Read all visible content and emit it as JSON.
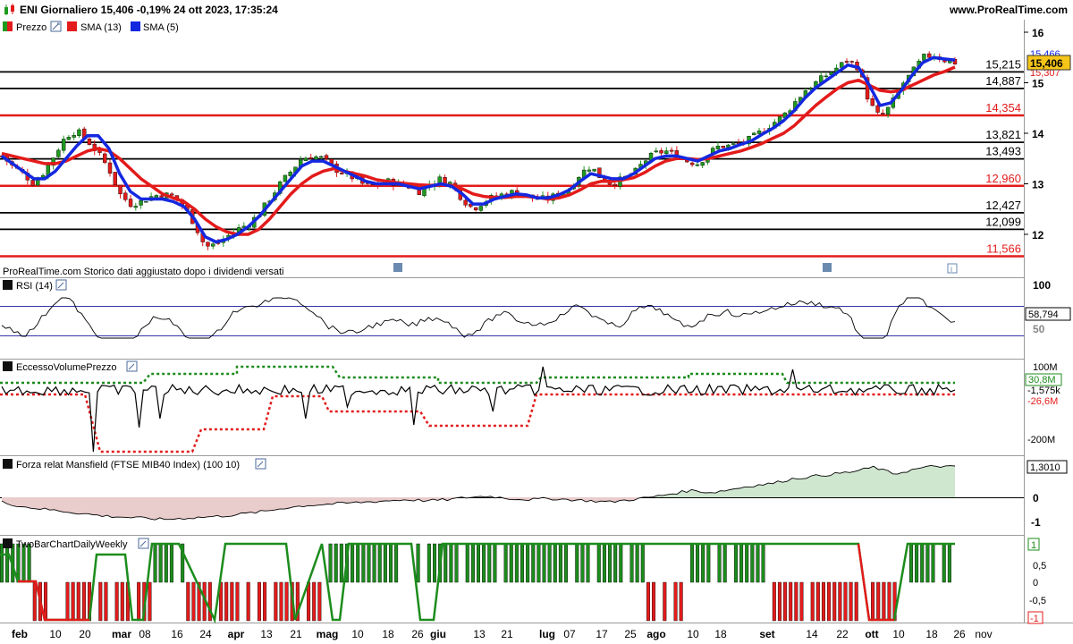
{
  "header": {
    "title": "ENI Giornaliero 15,406 -0,19% 24 ott 2023, 17:35:24",
    "site": "www.ProRealTime.com"
  },
  "colors": {
    "up": "#1f9a1f",
    "down": "#e31b1b",
    "sma_fast": "#1428e0",
    "sma_slow": "#e31b1b",
    "hline_black": "#000000",
    "hline_red": "#e31b1b",
    "rsi_band": "#3333aa",
    "volume_green": "#1c8c1c",
    "volume_red": "#e31b1b",
    "mansfield_pos_fill": "#cfe6cf",
    "mansfield_neg_fill": "#e9cccc",
    "twobar_green": "#1c8c1c",
    "twobar_red": "#e31b1b"
  },
  "panels": {
    "price": {
      "legend": [
        {
          "label": "Prezzo",
          "color": "#1f9a1f",
          "icon": "price-legend-icon"
        },
        {
          "label": "SMA (13)",
          "color": "#e31b1b",
          "icon": "sma13-legend-icon"
        },
        {
          "label": "SMA (5)",
          "color": "#1428e0",
          "icon": "sma5-legend-icon"
        }
      ],
      "note": "ProRealTime.com  Storico dati aggiustato dopo i dividendi versati",
      "y_ticks": [
        "16",
        "15",
        "14",
        "13",
        "12"
      ],
      "current_price": "15,406",
      "last_sma5": "15,466",
      "last_sma13": "15,307"
    },
    "rsi": {
      "title": "RSI (14)",
      "ticks": [
        "100",
        "50"
      ],
      "last": "58,794"
    },
    "volume": {
      "title": "EccessoVolumePrezzo",
      "ticks": [
        "100M",
        "-200M"
      ],
      "last_upper": "30,8M",
      "last_value": "-1,575k",
      "last_lower": "-26,6M"
    },
    "mansfield": {
      "title": "Forza relat Mansfield (FTSE MIB40 Index) (100 10)",
      "ticks": [
        "0",
        "-1"
      ],
      "last": "1,3010"
    },
    "twobar": {
      "title": "TwoBarChartDailyWeekly",
      "ticks": [
        "0,5",
        "0",
        "-0,5"
      ],
      "last_upper": "1",
      "last_lower": "-1"
    }
  },
  "x_axis": {
    "labels": [
      {
        "text": "feb",
        "bold": true
      },
      {
        "text": "10",
        "bold": false
      },
      {
        "text": "20",
        "bold": false
      },
      {
        "text": "mar",
        "bold": true
      },
      {
        "text": "08",
        "bold": false
      },
      {
        "text": "16",
        "bold": false
      },
      {
        "text": "24",
        "bold": false
      },
      {
        "text": "apr",
        "bold": true
      },
      {
        "text": "13",
        "bold": false
      },
      {
        "text": "21",
        "bold": false
      },
      {
        "text": "mag",
        "bold": true
      },
      {
        "text": "10",
        "bold": false
      },
      {
        "text": "18",
        "bold": false
      },
      {
        "text": "26",
        "bold": false
      },
      {
        "text": "giu",
        "bold": true
      },
      {
        "text": "13",
        "bold": false
      },
      {
        "text": "21",
        "bold": false
      },
      {
        "text": "lug",
        "bold": true
      },
      {
        "text": "07",
        "bold": false
      },
      {
        "text": "17",
        "bold": false
      },
      {
        "text": "25",
        "bold": false
      },
      {
        "text": "ago",
        "bold": true
      },
      {
        "text": "10",
        "bold": false
      },
      {
        "text": "18",
        "bold": false
      },
      {
        "text": "set",
        "bold": true
      },
      {
        "text": "14",
        "bold": false
      },
      {
        "text": "22",
        "bold": false
      },
      {
        "text": "ott",
        "bold": true
      },
      {
        "text": "10",
        "bold": false
      },
      {
        "text": "18",
        "bold": false
      },
      {
        "text": "26",
        "bold": false
      },
      {
        "text": "nov",
        "bold": false
      }
    ]
  },
  "chart_data": {
    "type": "line",
    "title": "ENI Giornaliero",
    "ylim": [
      11.3,
      16.3
    ],
    "horizontal_levels": [
      {
        "value": 15.215,
        "label": "15,215",
        "color": "black"
      },
      {
        "value": 14.887,
        "label": "14,887",
        "color": "black"
      },
      {
        "value": 14.354,
        "label": "14,354",
        "color": "red"
      },
      {
        "value": 13.821,
        "label": "13,821",
        "color": "black"
      },
      {
        "value": 13.493,
        "label": "13,493",
        "color": "black"
      },
      {
        "value": 12.96,
        "label": "12,960",
        "color": "red"
      },
      {
        "value": 12.427,
        "label": "12,427",
        "color": "black"
      },
      {
        "value": 12.099,
        "label": "12,099",
        "color": "black"
      },
      {
        "value": 11.566,
        "label": "11,566",
        "color": "red"
      }
    ],
    "price_path": [
      13.55,
      13.35,
      13.2,
      13.0,
      13.25,
      13.6,
      13.95,
      14.05,
      13.85,
      13.6,
      13.3,
      12.8,
      12.6,
      12.65,
      12.75,
      12.8,
      12.75,
      12.55,
      12.2,
      11.75,
      11.8,
      11.95,
      12.1,
      12.2,
      12.4,
      12.7,
      13.0,
      13.25,
      13.5,
      13.55,
      13.5,
      13.3,
      13.2,
      13.1,
      12.95,
      13.0,
      13.05,
      13.0,
      12.95,
      12.85,
      13.0,
      13.1,
      13.0,
      12.7,
      12.5,
      12.65,
      12.75,
      12.8,
      12.85,
      12.75,
      12.7,
      12.7,
      12.8,
      12.9,
      13.2,
      13.35,
      13.1,
      13.0,
      13.1,
      13.2,
      13.45,
      13.6,
      13.65,
      13.55,
      13.45,
      13.4,
      13.6,
      13.75,
      13.75,
      13.8,
      13.9,
      14.05,
      14.2,
      14.35,
      14.6,
      14.85,
      15.0,
      15.15,
      15.3,
      15.45,
      15.3,
      14.6,
      14.3,
      14.55,
      14.95,
      15.2,
      15.5,
      15.55,
      15.45,
      15.4
    ],
    "sma5": [
      13.55,
      13.4,
      13.25,
      13.1,
      13.1,
      13.25,
      13.5,
      13.75,
      13.95,
      13.95,
      13.7,
      13.2,
      12.85,
      12.7,
      12.7,
      12.7,
      12.65,
      12.55,
      12.3,
      11.95,
      11.85,
      11.9,
      12.0,
      12.15,
      12.35,
      12.6,
      12.85,
      13.1,
      13.35,
      13.45,
      13.45,
      13.35,
      13.25,
      13.15,
      13.05,
      13.0,
      13.0,
      13.0,
      12.95,
      12.9,
      12.95,
      13.0,
      12.95,
      12.8,
      12.6,
      12.6,
      12.7,
      12.75,
      12.8,
      12.78,
      12.72,
      12.72,
      12.78,
      12.88,
      13.05,
      13.2,
      13.15,
      13.1,
      13.1,
      13.2,
      13.35,
      13.5,
      13.55,
      13.55,
      13.5,
      13.45,
      13.55,
      13.65,
      13.7,
      13.78,
      13.85,
      13.98,
      14.1,
      14.25,
      14.45,
      14.7,
      14.9,
      15.05,
      15.2,
      15.35,
      15.3,
      14.95,
      14.55,
      14.6,
      14.85,
      15.15,
      15.4,
      15.5,
      15.47,
      15.45
    ],
    "sma13": [
      13.6,
      13.55,
      13.5,
      13.45,
      13.4,
      13.4,
      13.45,
      13.55,
      13.65,
      13.7,
      13.65,
      13.5,
      13.3,
      13.1,
      12.95,
      12.8,
      12.72,
      12.65,
      12.5,
      12.3,
      12.15,
      12.05,
      12.0,
      12.0,
      12.1,
      12.3,
      12.55,
      12.8,
      13.0,
      13.15,
      13.25,
      13.3,
      13.25,
      13.2,
      13.15,
      13.08,
      13.05,
      13.02,
      13.0,
      12.98,
      12.97,
      12.98,
      12.97,
      12.9,
      12.8,
      12.75,
      12.73,
      12.73,
      12.75,
      12.75,
      12.73,
      12.7,
      12.72,
      12.78,
      12.88,
      13.0,
      13.05,
      13.05,
      13.08,
      13.12,
      13.22,
      13.35,
      13.45,
      13.5,
      13.5,
      13.48,
      13.5,
      13.55,
      13.6,
      13.65,
      13.72,
      13.8,
      13.9,
      14.0,
      14.15,
      14.35,
      14.55,
      14.72,
      14.88,
      15.0,
      15.05,
      14.95,
      14.85,
      14.82,
      14.85,
      14.95,
      15.05,
      15.15,
      15.22,
      15.31
    ]
  }
}
